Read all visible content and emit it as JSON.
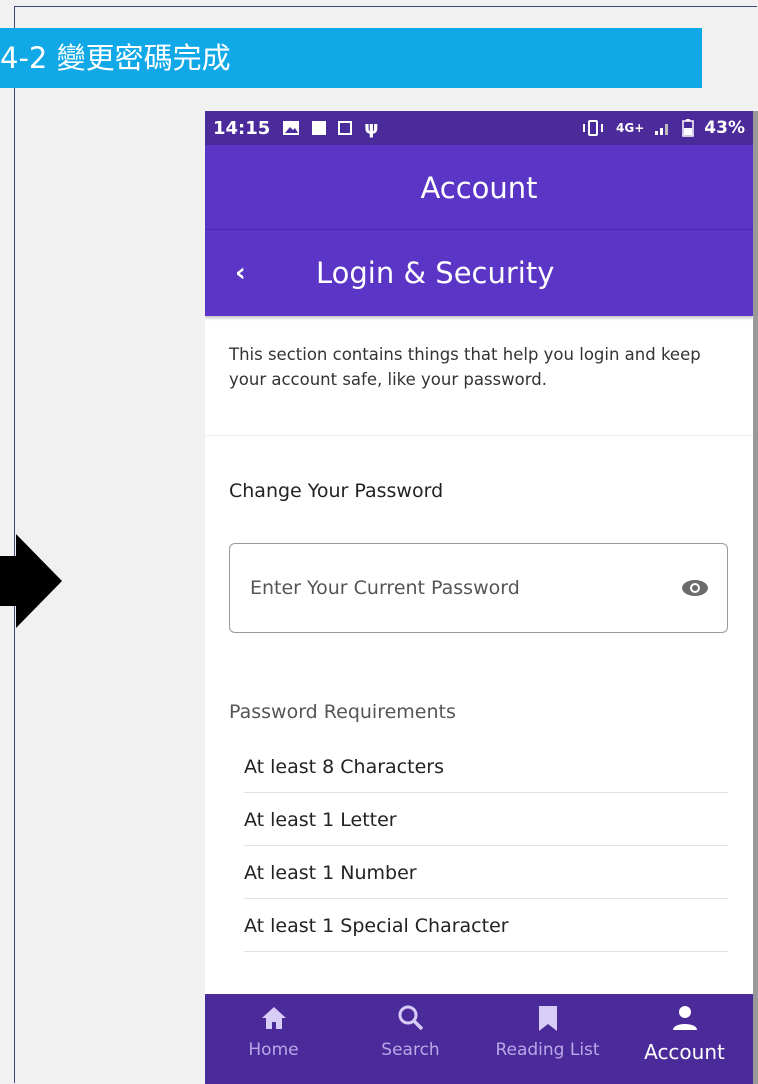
{
  "slide": {
    "title": "4-2 變更密碼完成"
  },
  "status_bar": {
    "time": "14:15",
    "network": "4G+",
    "battery": "43%"
  },
  "header": {
    "title": "Account",
    "sub_title": "Login & Security",
    "back_glyph": "‹"
  },
  "intro": {
    "text": "This section contains things that help you login and keep your account safe, like your password."
  },
  "change_password": {
    "title": "Change Your Password",
    "current_placeholder": "Enter Your Current Password"
  },
  "requirements": {
    "title": "Password Requirements",
    "items": [
      "At least 8 Characters",
      "At least 1 Letter",
      "At least 1 Number",
      "At least 1 Special Character"
    ]
  },
  "nav": {
    "items": [
      {
        "label": "Home",
        "icon": "home-icon"
      },
      {
        "label": "Search",
        "icon": "search-icon"
      },
      {
        "label": "Reading List",
        "icon": "bookmark-icon"
      },
      {
        "label": "Account",
        "icon": "person-icon"
      }
    ],
    "active": "Account"
  },
  "colors": {
    "slide_banner": "#11a8e8",
    "status_bar": "#4b2a9a",
    "header": "#5b35c6",
    "nav": "#4b2a9a"
  }
}
